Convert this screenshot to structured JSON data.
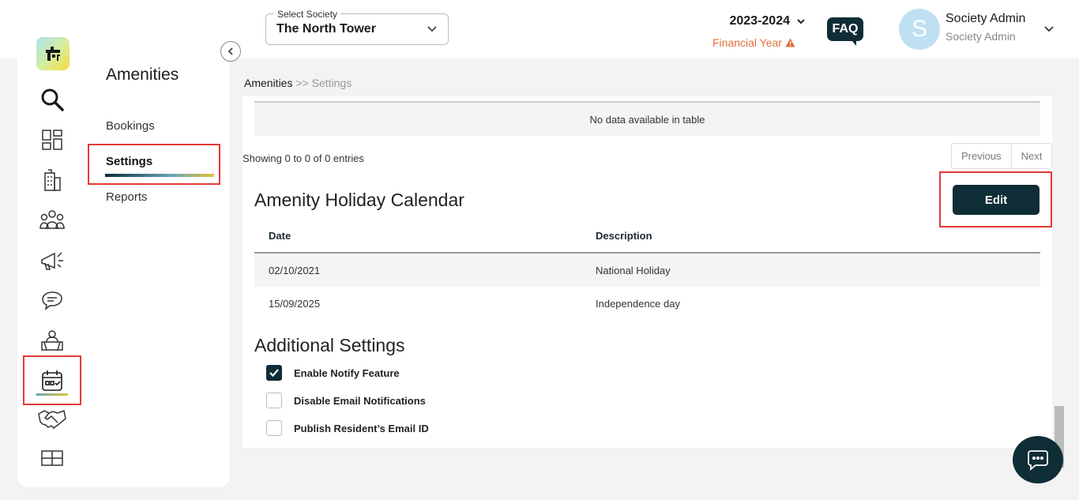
{
  "header": {
    "society_select": {
      "label": "Select Society",
      "value": "The North Tower"
    },
    "financial_year": {
      "year": "2023-2024",
      "label": "Financial Year"
    },
    "faq_label": "FAQ",
    "user": {
      "initial": "S",
      "name": "Society Admin",
      "role": "Society Admin"
    }
  },
  "sidebar": {
    "title": "Amenities",
    "items": [
      {
        "label": "Bookings"
      },
      {
        "label": "Settings"
      },
      {
        "label": "Reports"
      }
    ],
    "rail_icons": [
      "search-icon",
      "dashboard-icon",
      "building-icon",
      "community-icon",
      "announcement-icon",
      "chat-icon",
      "helpdesk-icon",
      "amenities-calendar-icon",
      "handshake-icon",
      "box-icon"
    ]
  },
  "breadcrumb": {
    "parent": "Amenities",
    "separator": ">>",
    "current": "Settings"
  },
  "top_table": {
    "empty_text": "No data available in table",
    "showing_text": "Showing 0 to 0 of 0 entries",
    "pager": {
      "previous": "Previous",
      "next": "Next"
    }
  },
  "holiday_calendar": {
    "title": "Amenity Holiday Calendar",
    "edit_label": "Edit",
    "columns": [
      "Date",
      "Description"
    ],
    "rows": [
      {
        "date": "02/10/2021",
        "description": "National Holiday"
      },
      {
        "date": "15/09/2025",
        "description": "Independence day"
      }
    ]
  },
  "additional_settings": {
    "title": "Additional Settings",
    "options": [
      {
        "label": "Enable Notify Feature",
        "checked": true
      },
      {
        "label": "Disable Email Notifications",
        "checked": false
      },
      {
        "label": "Publish Resident’s Email ID",
        "checked": false
      }
    ]
  },
  "colors": {
    "primary": "#0f2d36",
    "highlight": "#e53935",
    "warning": "#e2703a"
  }
}
